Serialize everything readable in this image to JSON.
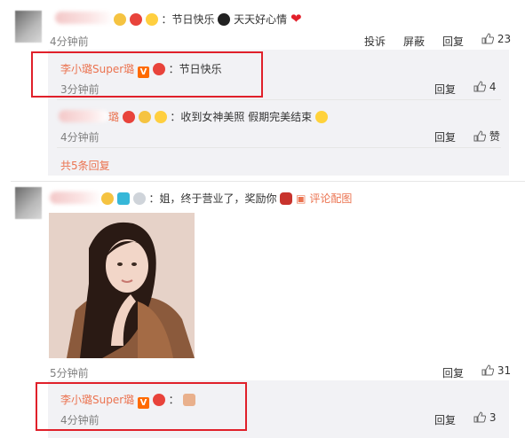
{
  "comments": [
    {
      "text": "：节日快乐",
      "text_tail": "天天好心情",
      "time": "4分钟前",
      "actions": {
        "report": "投诉",
        "block": "屏蔽",
        "reply": "回复",
        "like_count": "23"
      },
      "replies": [
        {
          "name": "李小璐Super璐",
          "text": "：节日快乐",
          "time": "3分钟前",
          "reply": "回复",
          "like_count": "4"
        },
        {
          "name_tail": "璐",
          "text": "：收到女神美照 假期完美结束",
          "time": "4分钟前",
          "reply": "回复",
          "like_label": "赞"
        }
      ],
      "more_replies": "共5条回复"
    },
    {
      "text": "：姐，终于营业了，奖励你",
      "photo_link": "评论配图",
      "time": "5分钟前",
      "actions": {
        "reply": "回复",
        "like_count": "31"
      },
      "replies": [
        {
          "name": "李小璐Super璐",
          "text": "：",
          "time": "4分钟前",
          "reply": "回复",
          "like_count": "3"
        }
      ]
    }
  ],
  "colors": {
    "name": "#eb7350",
    "highlight_border": "#e0202a",
    "reply_bg": "#f2f2f5",
    "vip_badge": "#ff6a00"
  },
  "icons": [
    "thumb-up-icon",
    "v-badge-icon",
    "emoji-icon",
    "heart-icon",
    "image-icon",
    "camera-badge-icon"
  ]
}
